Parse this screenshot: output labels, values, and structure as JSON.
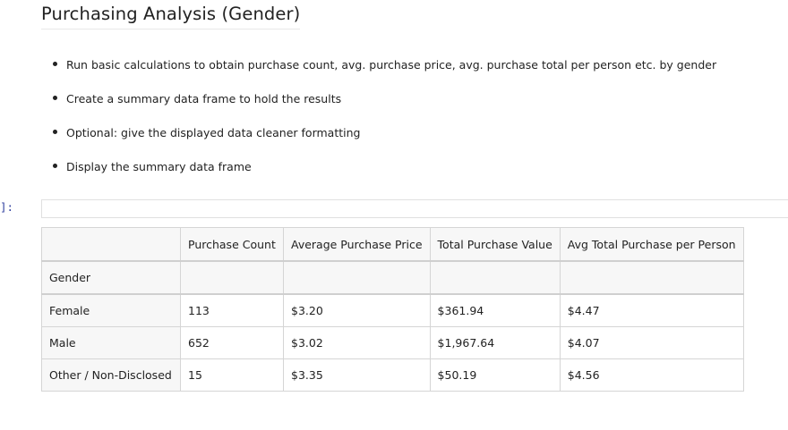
{
  "heading": "Purchasing Analysis (Gender)",
  "bullets": [
    "Run basic calculations to obtain purchase count, avg. purchase price, avg. purchase total per person etc. by gender",
    "Create a summary data frame to hold the results",
    "Optional: give the displayed data cleaner formatting",
    "Display the summary data frame"
  ],
  "cell": {
    "prompt": "]:",
    "input_value": ""
  },
  "table": {
    "columns": [
      "",
      "Purchase Count",
      "Average Purchase Price",
      "Total Purchase Value",
      "Avg Total Purchase per Person"
    ],
    "index_name": "Gender",
    "rows": [
      [
        "Female",
        "113",
        "$3.20",
        "$361.94",
        "$4.47"
      ],
      [
        "Male",
        "652",
        "$3.02",
        "$1,967.64",
        "$4.07"
      ],
      [
        "Other / Non-Disclosed",
        "15",
        "$3.35",
        "$50.19",
        "$4.56"
      ]
    ]
  }
}
